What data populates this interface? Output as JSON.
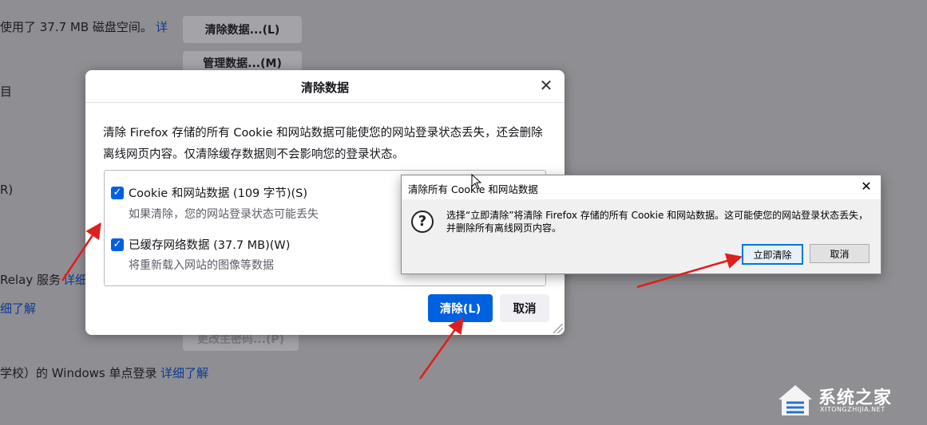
{
  "background": {
    "storage_text": "使用了 37.7 MB 磁盘空间。",
    "storage_link": "详",
    "clear_data_button": "清除数据...(L)",
    "manage_data_button": "管理数据...(M)",
    "fragment_a": "目",
    "fragment_r": "R)",
    "relay_text": "Relay 服务",
    "relay_link": "详细",
    "learn_more_link": "细了解",
    "change_password_button": "更改主密码...(P)",
    "windows_sso_text": "学校）的 Windows 单点登录",
    "windows_sso_link": "详细了解"
  },
  "firefox_dialog": {
    "title": "清除数据",
    "description": "清除 Firefox 存储的所有 Cookie 和网站数据可能使您的网站登录状态丢失，还会删除离线网页内容。仅清除缓存数据则不会影响您的登录状态。",
    "options": [
      {
        "label": "Cookie 和网站数据 (109 字节)(S)",
        "description": "如果清除，您的网站登录状态可能丢失",
        "checked": true
      },
      {
        "label": "已缓存网络数据 (37.7 MB)(W)",
        "description": "将重新载入网站的图像等数据",
        "checked": true
      }
    ],
    "clear_button": "清除(L)",
    "cancel_button": "取消"
  },
  "confirm_dialog": {
    "title": "清除所有 Cookie 和网站数据",
    "message": "选择“立即清除”将清除 Firefox 存储的所有 Cookie 和网站数据。这可能使您的网站登录状态丢失，并删除所有离线网页内容。",
    "confirm_button": "立即清除",
    "cancel_button": "取消"
  },
  "watermark": {
    "name": "系统之家",
    "url": "XITONGZHIJIA.NET"
  },
  "colors": {
    "accent": "#0061e0",
    "annotation_arrow": "#e01e1e",
    "overlay": "#8f8f93"
  }
}
